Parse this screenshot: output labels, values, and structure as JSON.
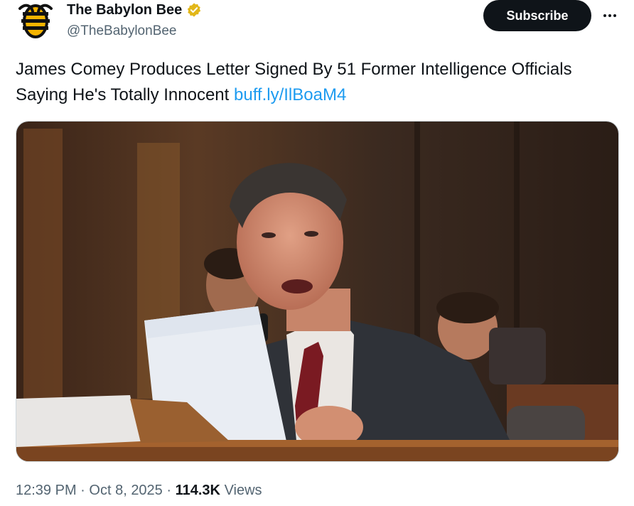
{
  "account": {
    "display_name": "The Babylon Bee",
    "handle": "@TheBabylonBee",
    "avatar_icon": "bee-logo-icon",
    "verified_icon": "verified-badge-icon",
    "brand_color": "#f5b400"
  },
  "actions": {
    "subscribe_label": "Subscribe",
    "more_icon": "more-options-icon"
  },
  "tweet": {
    "text": "James Comey Produces Letter Signed By 51 Former Intelligence Officials Saying He's Totally Innocent",
    "link_text": "buff.ly/IlBoaM4",
    "link_color": "#1d9bf0"
  },
  "media": {
    "type": "photo"
  },
  "meta": {
    "time": "12:39 PM",
    "separator": "·",
    "date": "Oct 8, 2025",
    "views_count": "114.3K",
    "views_label": "Views"
  }
}
